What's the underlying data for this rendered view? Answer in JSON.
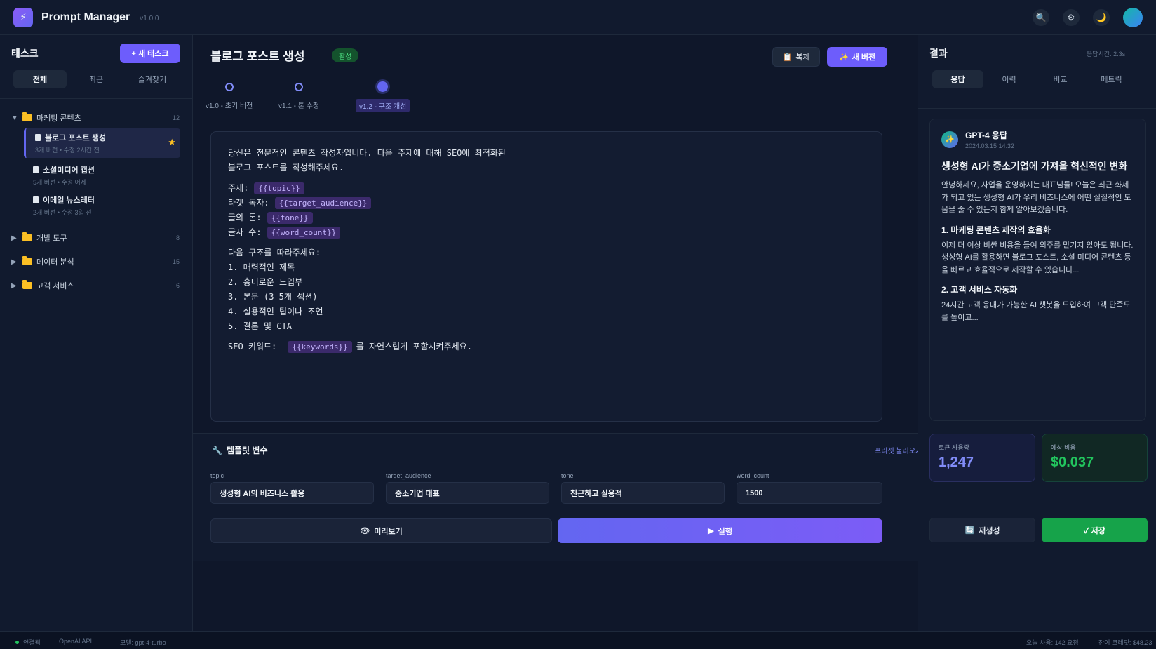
{
  "header": {
    "logo_glyph": "⚡",
    "title": "Prompt Manager",
    "version": "v1.0.0",
    "search_icon": "🔍",
    "settings_icon": "⚙",
    "theme_icon": "🌙",
    "accent_color": "#6d5dfc"
  },
  "sidebar": {
    "title": "태스크",
    "new_task_label": "+ 새 태스크",
    "tabs": [
      "전체",
      "최근",
      "즐겨찾기"
    ],
    "folders": [
      {
        "name": "마케팅 콘텐츠",
        "count": "12",
        "expanded": true
      },
      {
        "name": "개발 도구",
        "count": "8",
        "expanded": false
      },
      {
        "name": "데이터 분석",
        "count": "15",
        "expanded": false
      },
      {
        "name": "고객 서비스",
        "count": "6",
        "expanded": false
      }
    ],
    "tasks": [
      {
        "name": "블로그 포스트 생성",
        "meta": "3개 버전 • 수정 2시간 전",
        "starred": true
      },
      {
        "name": "소셜미디어 캡션",
        "meta": "5개 버전 • 수정 어제"
      },
      {
        "name": "이메일 뉴스레터",
        "meta": "2개 버전 • 수정 3일 전"
      }
    ]
  },
  "main": {
    "title": "블로그 포스트 생성",
    "status": "활성",
    "duplicate_label": "복제",
    "new_version_label": "새 버전",
    "versions": [
      "v1.0 - 초기 버전",
      "v1.1 - 톤 수정",
      "v1.2 - 구조 개선"
    ],
    "active_version": 2,
    "editor": {
      "intro_1": "당신은 전문적인 콘텐츠 작성자입니다. 다음 주제에 대해 SEO에 최적화된",
      "intro_2": "블로그 포스트를 작성해주세요.",
      "vars": [
        {
          "label": "주제:",
          "chip": "{{topic}}"
        },
        {
          "label": "타겟 독자:",
          "chip": "{{target_audience}}"
        },
        {
          "label": "글의 톤:",
          "chip": "{{tone}}"
        },
        {
          "label": "글자 수:",
          "chip": "{{word_count}}"
        }
      ],
      "structure_intro": "다음 구조를 따라주세요:",
      "structure": [
        "1. 매력적인 제목",
        "2. 흥미로운 도입부",
        "3. 본문 (3-5개 섹션)",
        "4. 실용적인 팁이나 조언",
        "5. 결론 및 CTA"
      ],
      "seo_prefix": "SEO 키워드:",
      "seo_chip": "{{keywords}}",
      "seo_suffix": "를 자연스럽게 포함시켜주세요."
    },
    "variables": {
      "title": "템플릿 변수",
      "preset_link": "프리셋 불러오기",
      "fields": [
        {
          "label": "topic",
          "value": "생성형 AI의 비즈니스 활용"
        },
        {
          "label": "target_audience",
          "value": "중소기업 대표"
        },
        {
          "label": "tone",
          "value": "친근하고 실용적"
        },
        {
          "label": "word_count",
          "value": "1500"
        }
      ]
    },
    "preview_label": "미리보기",
    "run_label": "실행"
  },
  "result": {
    "title": "결과",
    "response_time": "응답시간: 2.3s",
    "tabs": [
      "응답",
      "이력",
      "비교",
      "메트릭"
    ],
    "model_name": "GPT-4 응답",
    "model_date": "2024.03.15 14:32",
    "heading": "생성형 AI가 중소기업에 가져올 혁신적인 변화",
    "para_1": "안녕하세요, 사업을 운영하시는 대표님들! 오늘은 최근 화제가 되고 있는 생성형 AI가 우리 비즈니스에 어떤 실질적인 도움을 줄 수 있는지 함께 알아보겠습니다.",
    "section_1_title": "1. 마케팅 콘텐츠 제작의 효율화",
    "section_1_text": "이제 더 이상 비싼 비용을 들여 외주를 맡기지 않아도 됩니다. 생성형 AI를 활용하면 블로그 포스트, 소셜 미디어 콘텐츠 등을 빠르고 효율적으로 제작할 수 있습니다...",
    "section_2_title": "2. 고객 서비스 자동화",
    "section_2_text": "24시간 고객 응대가 가능한 AI 챗봇을 도입하여 고객 만족도를 높이고...",
    "tokens_label": "토큰 사용량",
    "tokens_value": "1,247",
    "cost_label": "예상 비용",
    "cost_value": "$0.037",
    "regen_label": "재생성",
    "save_label": "✓ 저장"
  },
  "statusbar": {
    "connection": "연결됨",
    "api": "OpenAI API",
    "model": "모델: gpt-4-turbo",
    "usage": "오늘 사용: 142 요청",
    "credits": "잔여 크레딧: $48.23"
  }
}
